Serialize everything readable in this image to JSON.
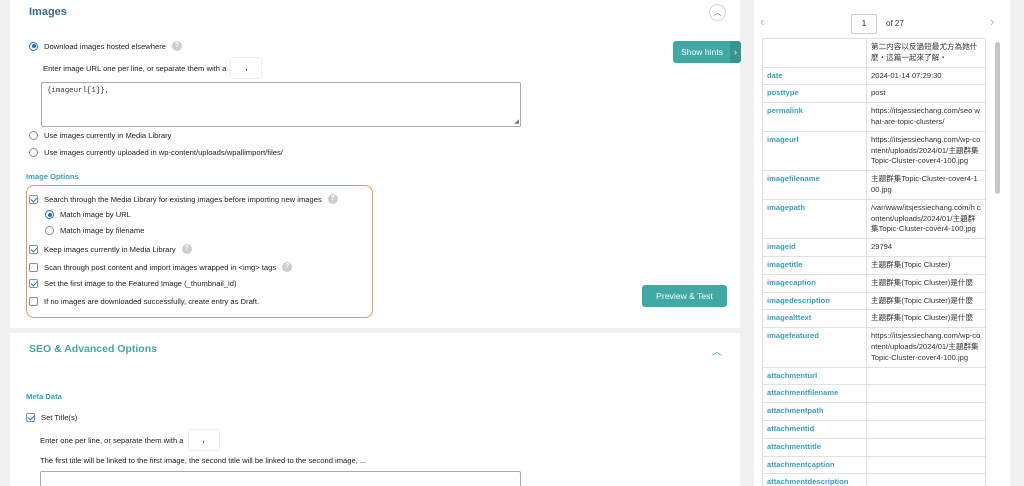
{
  "images": {
    "title": "Images",
    "collapse_icon": "chevron-up-icon",
    "download_label": "Download images hosted elsewhere",
    "url_hint": "Enter image URL one per line, or separate them with a",
    "separator": ",",
    "url_value": "{imageurl[1]},",
    "media_library_label": "Use images currently in Media Library",
    "uploaded_label": "Use images currently uploaded in wp-content/uploads/wpallimport/files/",
    "options_title": "Image Options",
    "search_label": "Search through the Media Library for existing images before importing new images",
    "match_url_label": "Match image by URL",
    "match_filename_label": "Match image by filename",
    "keep_label": "Keep images currently in Media Library",
    "scan_label": "Scan through post content and import images wrapped in <img> tags",
    "featured_label": "Set the first image to the Featured Image (_thumbnail_id)",
    "draft_label": "If no images are downloaded successfully, create entry as Draft.",
    "help_glyph": "?"
  },
  "buttons": {
    "show_hints": "Show hints",
    "show_hints_arrow": "›",
    "preview": "Preview & Test"
  },
  "seo": {
    "title": "SEO & Advanced Options",
    "collapse_icon": "chevron-up-icon",
    "meta_title": "Meta Data",
    "set_title_label": "Set Title(s)",
    "title_hint": "Enter one per line, or separate them with a",
    "separator": ",",
    "link_hint": "The first title will be linked to the first image, the second title will be linked to the second image, ..."
  },
  "preview": {
    "page": "1",
    "of_text": "of 27",
    "prev_arrow": "‹",
    "next_arrow": "›",
    "rows": [
      {
        "k": "",
        "v": "第二内容以反過短最尤方為她什麼・這篇一起來了解・"
      },
      {
        "k": "date",
        "v": "2024-01-14 07:29:30"
      },
      {
        "k": "posttype",
        "v": "post"
      },
      {
        "k": "permalink",
        "v": "https://itsjessiechang.com/seo what-are-topic-clusters/"
      },
      {
        "k": "imageurl",
        "v": "https://itsjessiechang.com/wp-content/uploads/2024/01/主題群集Topic-Cluster-cover4-100.jpg"
      },
      {
        "k": "imagefilename",
        "v": "主題群集Topic-Cluster-cover4-100.jpg"
      },
      {
        "k": "imagepath",
        "v": "/var/www/itsjessiechang.com/h content/uploads/2024/01/主題群集Topic-Cluster-cover4-100.jpg"
      },
      {
        "k": "imageid",
        "v": "29794"
      },
      {
        "k": "imagetitle",
        "v": "主題群集(Topic Cluster)"
      },
      {
        "k": "imagecaption",
        "v": "主題群集(Topic Cluster)是什麼"
      },
      {
        "k": "imagedescription",
        "v": "主題群集(Topic Cluster)是什麼"
      },
      {
        "k": "imagealttext",
        "v": "主題群集(Topic Cluster)是什麼"
      },
      {
        "k": "imagefeatured",
        "v": "https://itsjessiechang.com/wp-content/uploads/2024/01/主題群集Topic-Cluster-cover4-100.jpg"
      },
      {
        "k": "attachmenturl",
        "v": ""
      },
      {
        "k": "attachmentfilename",
        "v": ""
      },
      {
        "k": "attachmentpath",
        "v": ""
      },
      {
        "k": "attachmentid",
        "v": ""
      },
      {
        "k": "attachmenttitle",
        "v": ""
      },
      {
        "k": "attachmentcaption",
        "v": ""
      },
      {
        "k": "attachmentdescription",
        "v": ""
      }
    ]
  },
  "colors": {
    "accent_teal": "#40a9a4",
    "title_blue": "#3a6a9c",
    "key_blue": "#3a9ec2",
    "highlight_orange": "#e39a57"
  }
}
